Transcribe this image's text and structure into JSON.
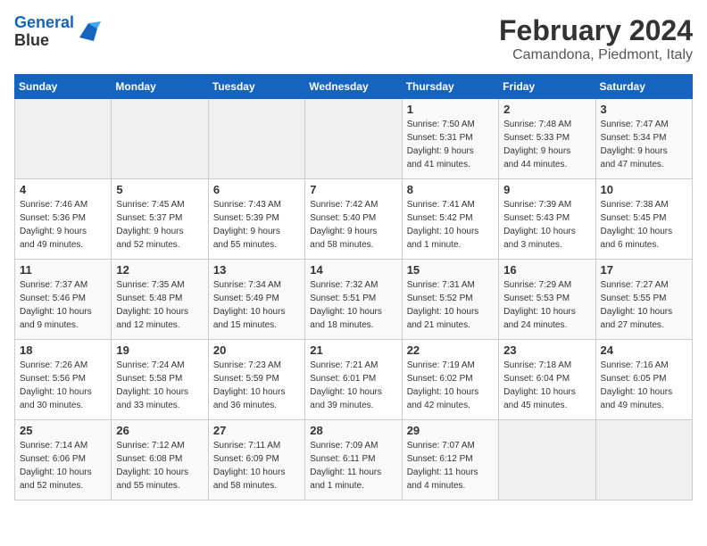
{
  "header": {
    "logo_line1": "General",
    "logo_line2": "Blue",
    "month_title": "February 2024",
    "location": "Camandona, Piedmont, Italy"
  },
  "days_of_week": [
    "Sunday",
    "Monday",
    "Tuesday",
    "Wednesday",
    "Thursday",
    "Friday",
    "Saturday"
  ],
  "weeks": [
    [
      {
        "day": "",
        "info": ""
      },
      {
        "day": "",
        "info": ""
      },
      {
        "day": "",
        "info": ""
      },
      {
        "day": "",
        "info": ""
      },
      {
        "day": "1",
        "info": "Sunrise: 7:50 AM\nSunset: 5:31 PM\nDaylight: 9 hours\nand 41 minutes."
      },
      {
        "day": "2",
        "info": "Sunrise: 7:48 AM\nSunset: 5:33 PM\nDaylight: 9 hours\nand 44 minutes."
      },
      {
        "day": "3",
        "info": "Sunrise: 7:47 AM\nSunset: 5:34 PM\nDaylight: 9 hours\nand 47 minutes."
      }
    ],
    [
      {
        "day": "4",
        "info": "Sunrise: 7:46 AM\nSunset: 5:36 PM\nDaylight: 9 hours\nand 49 minutes."
      },
      {
        "day": "5",
        "info": "Sunrise: 7:45 AM\nSunset: 5:37 PM\nDaylight: 9 hours\nand 52 minutes."
      },
      {
        "day": "6",
        "info": "Sunrise: 7:43 AM\nSunset: 5:39 PM\nDaylight: 9 hours\nand 55 minutes."
      },
      {
        "day": "7",
        "info": "Sunrise: 7:42 AM\nSunset: 5:40 PM\nDaylight: 9 hours\nand 58 minutes."
      },
      {
        "day": "8",
        "info": "Sunrise: 7:41 AM\nSunset: 5:42 PM\nDaylight: 10 hours\nand 1 minute."
      },
      {
        "day": "9",
        "info": "Sunrise: 7:39 AM\nSunset: 5:43 PM\nDaylight: 10 hours\nand 3 minutes."
      },
      {
        "day": "10",
        "info": "Sunrise: 7:38 AM\nSunset: 5:45 PM\nDaylight: 10 hours\nand 6 minutes."
      }
    ],
    [
      {
        "day": "11",
        "info": "Sunrise: 7:37 AM\nSunset: 5:46 PM\nDaylight: 10 hours\nand 9 minutes."
      },
      {
        "day": "12",
        "info": "Sunrise: 7:35 AM\nSunset: 5:48 PM\nDaylight: 10 hours\nand 12 minutes."
      },
      {
        "day": "13",
        "info": "Sunrise: 7:34 AM\nSunset: 5:49 PM\nDaylight: 10 hours\nand 15 minutes."
      },
      {
        "day": "14",
        "info": "Sunrise: 7:32 AM\nSunset: 5:51 PM\nDaylight: 10 hours\nand 18 minutes."
      },
      {
        "day": "15",
        "info": "Sunrise: 7:31 AM\nSunset: 5:52 PM\nDaylight: 10 hours\nand 21 minutes."
      },
      {
        "day": "16",
        "info": "Sunrise: 7:29 AM\nSunset: 5:53 PM\nDaylight: 10 hours\nand 24 minutes."
      },
      {
        "day": "17",
        "info": "Sunrise: 7:27 AM\nSunset: 5:55 PM\nDaylight: 10 hours\nand 27 minutes."
      }
    ],
    [
      {
        "day": "18",
        "info": "Sunrise: 7:26 AM\nSunset: 5:56 PM\nDaylight: 10 hours\nand 30 minutes."
      },
      {
        "day": "19",
        "info": "Sunrise: 7:24 AM\nSunset: 5:58 PM\nDaylight: 10 hours\nand 33 minutes."
      },
      {
        "day": "20",
        "info": "Sunrise: 7:23 AM\nSunset: 5:59 PM\nDaylight: 10 hours\nand 36 minutes."
      },
      {
        "day": "21",
        "info": "Sunrise: 7:21 AM\nSunset: 6:01 PM\nDaylight: 10 hours\nand 39 minutes."
      },
      {
        "day": "22",
        "info": "Sunrise: 7:19 AM\nSunset: 6:02 PM\nDaylight: 10 hours\nand 42 minutes."
      },
      {
        "day": "23",
        "info": "Sunrise: 7:18 AM\nSunset: 6:04 PM\nDaylight: 10 hours\nand 45 minutes."
      },
      {
        "day": "24",
        "info": "Sunrise: 7:16 AM\nSunset: 6:05 PM\nDaylight: 10 hours\nand 49 minutes."
      }
    ],
    [
      {
        "day": "25",
        "info": "Sunrise: 7:14 AM\nSunset: 6:06 PM\nDaylight: 10 hours\nand 52 minutes."
      },
      {
        "day": "26",
        "info": "Sunrise: 7:12 AM\nSunset: 6:08 PM\nDaylight: 10 hours\nand 55 minutes."
      },
      {
        "day": "27",
        "info": "Sunrise: 7:11 AM\nSunset: 6:09 PM\nDaylight: 10 hours\nand 58 minutes."
      },
      {
        "day": "28",
        "info": "Sunrise: 7:09 AM\nSunset: 6:11 PM\nDaylight: 11 hours\nand 1 minute."
      },
      {
        "day": "29",
        "info": "Sunrise: 7:07 AM\nSunset: 6:12 PM\nDaylight: 11 hours\nand 4 minutes."
      },
      {
        "day": "",
        "info": ""
      },
      {
        "day": "",
        "info": ""
      }
    ]
  ]
}
